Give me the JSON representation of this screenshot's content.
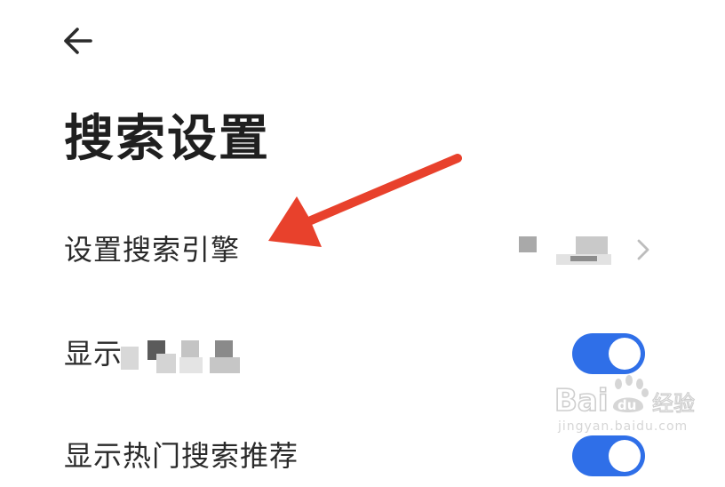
{
  "header": {
    "back_icon": "arrow-left-icon",
    "title": "搜索设置"
  },
  "settings": {
    "search_engine": {
      "label": "设置搜索引擎",
      "value_note": "pixelated / obscured value",
      "chevron_icon": "chevron-right-icon"
    },
    "show_search_history": {
      "label_prefix": "显示",
      "label_note": "remainder of label pixelated / obscured",
      "enabled": true
    },
    "show_hot_search": {
      "label": "显示热门搜索推荐",
      "enabled": true
    }
  },
  "annotation": {
    "arrow_color": "#e8412c"
  },
  "watermark": {
    "brand": "Baidu经验",
    "domain": "jingyan.baidu.com"
  },
  "colors": {
    "toggle_on": "#2f6fe8",
    "text": "#222222"
  }
}
